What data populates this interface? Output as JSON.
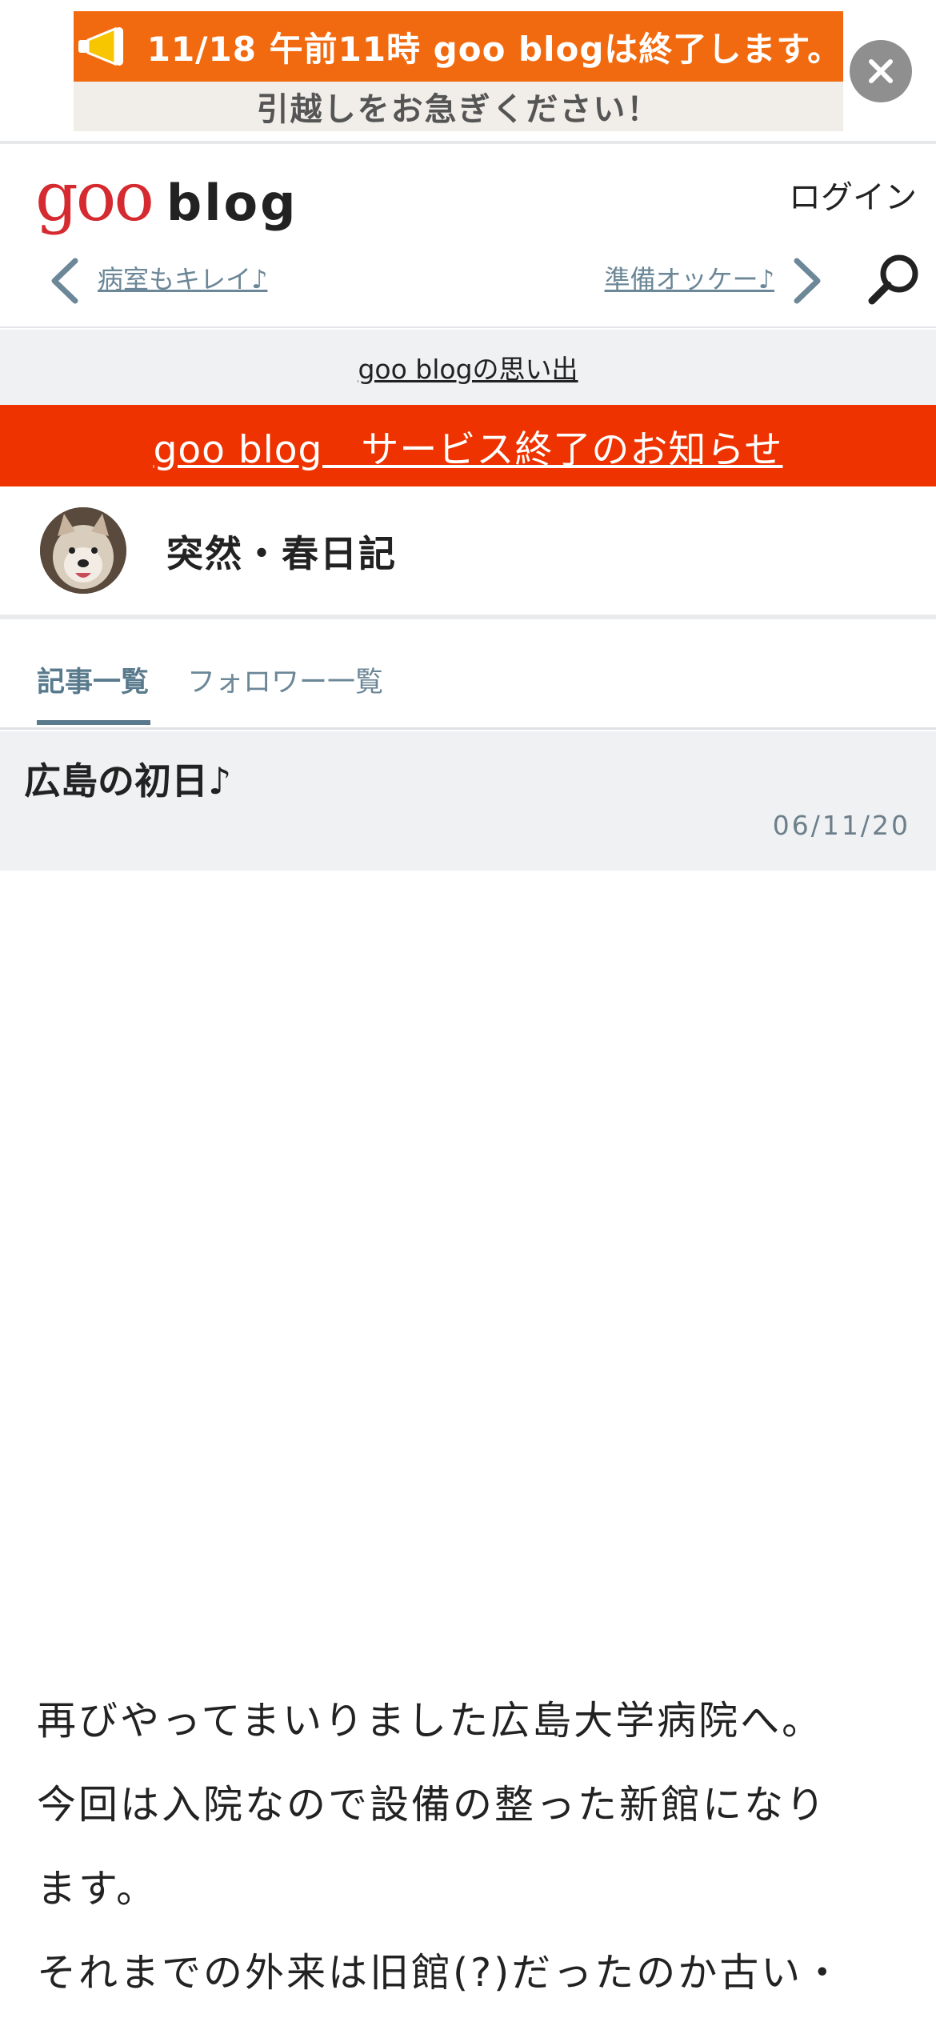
{
  "banner": {
    "line1": "11/18 午前11時 goo blogは終了します。",
    "line2": "引越しをお急ぎください！",
    "close_icon": "close-icon"
  },
  "header": {
    "logo_goo": "goo",
    "logo_blog": "blog",
    "login": "ログイン",
    "prev_article": "病室もキレイ♪",
    "next_article": "準備オッケー♪"
  },
  "memories_link": "goo blogの思い出",
  "service_end_link": "goo blog　サービス終了のお知らせ",
  "blog": {
    "title": "突然・春日記"
  },
  "tabs": [
    {
      "label": "記事一覧"
    },
    {
      "label": "フォロワー一覧"
    }
  ],
  "article": {
    "title": "広島の初日♪",
    "date": "06/11/20",
    "body": [
      "再びやってまいりました広島大学病院へ。",
      "今回は入院なので設備の整った新館になり",
      "ます。",
      "それまでの外来は旧館(?)だったのか古い・"
    ]
  },
  "colors": {
    "banner_orange": "#f26a10",
    "service_end_red": "#ee3300",
    "link_blue_gray": "#6c8797",
    "goo_red": "#d52a2f"
  }
}
